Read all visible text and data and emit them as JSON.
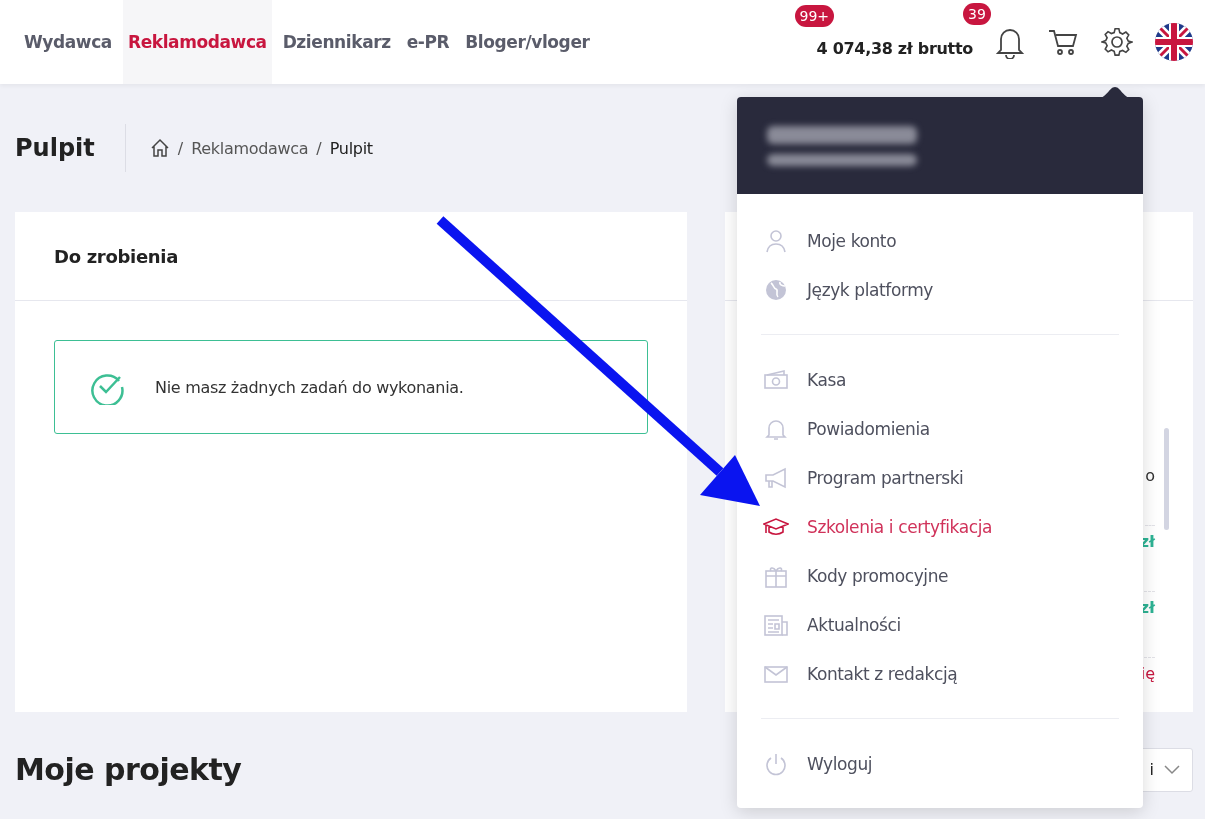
{
  "nav": {
    "tabs": [
      {
        "label": "Wydawca",
        "selected": false
      },
      {
        "label": "Reklamodawca",
        "selected": true
      },
      {
        "label": "Dziennikarz",
        "selected": false
      },
      {
        "label": "e-PR",
        "selected": false
      },
      {
        "label": "Bloger/vloger",
        "selected": false
      }
    ],
    "balance": {
      "badge": "99+",
      "amount": "4 074,38 zł brutto"
    },
    "notifications": {
      "badge": "39"
    }
  },
  "page": {
    "title": "Pulpit",
    "breadcrumb": [
      {
        "separator": "/",
        "label": "Reklamodawca"
      },
      {
        "separator": "/",
        "label": "Pulpit"
      }
    ]
  },
  "todo_card": {
    "title": "Do zrobienia",
    "alert": "Nie masz żadnych zadań do wykonania."
  },
  "side_card": {
    "fragments": [
      {
        "text": "o",
        "kind": "plain"
      },
      {
        "text": "zł",
        "kind": "amount"
      },
      {
        "text": "zł",
        "kind": "amount"
      },
      {
        "text": "ię",
        "kind": "link"
      }
    ]
  },
  "projects": {
    "title": "Moje projekty",
    "select_value": "i"
  },
  "account_menu": {
    "groups": [
      [
        {
          "label": "Moje konto",
          "kind": "user",
          "selected": false
        },
        {
          "label": "Język platformy",
          "kind": "globe",
          "selected": false
        }
      ],
      [
        {
          "label": "Kasa",
          "kind": "cash",
          "selected": false
        },
        {
          "label": "Powiadomienia",
          "kind": "bell",
          "selected": false
        },
        {
          "label": "Program partnerski",
          "kind": "megaphone",
          "selected": false
        },
        {
          "label": "Szkolenia i certyfikacja",
          "kind": "cap",
          "selected": true
        },
        {
          "label": "Kody promocyjne",
          "kind": "gift",
          "selected": false
        },
        {
          "label": "Aktualności",
          "kind": "news",
          "selected": false
        },
        {
          "label": "Kontakt z redakcją",
          "kind": "mail",
          "selected": false
        }
      ],
      [
        {
          "label": "Wyloguj",
          "kind": "power",
          "selected": false
        }
      ]
    ]
  }
}
